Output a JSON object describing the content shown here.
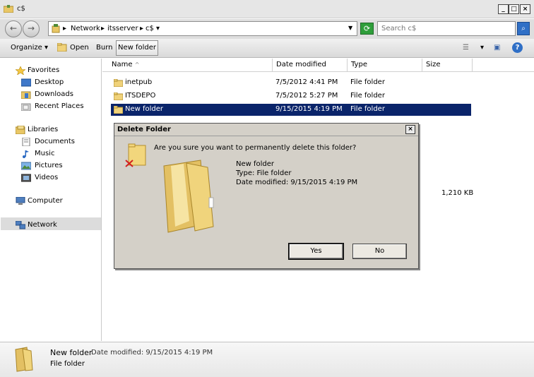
{
  "window": {
    "title": "c$"
  },
  "address": {
    "crumbs": [
      "Network",
      "itsserver",
      "c$"
    ]
  },
  "search": {
    "placeholder": "Search c$"
  },
  "toolbar": {
    "organize": "Organize",
    "open": "Open",
    "burn": "Burn",
    "new_folder": "New folder"
  },
  "nav": {
    "favorites": "Favorites",
    "desktop": "Desktop",
    "downloads": "Downloads",
    "recent_places": "Recent Places",
    "libraries": "Libraries",
    "documents": "Documents",
    "music": "Music",
    "pictures": "Pictures",
    "videos": "Videos",
    "computer": "Computer",
    "network": "Network"
  },
  "columns": {
    "name": "Name",
    "date_modified": "Date modified",
    "type": "Type",
    "size": "Size"
  },
  "files": [
    {
      "name": "inetpub",
      "date": "7/5/2012 4:41 PM",
      "type": "File folder"
    },
    {
      "name": "ITSDEPO",
      "date": "7/5/2012 5:27 PM",
      "type": "File folder"
    },
    {
      "name": "New folder",
      "date": "9/15/2015 4:19 PM",
      "type": "File folder"
    }
  ],
  "partial_size": "1,210 KB",
  "dialog": {
    "title": "Delete Folder",
    "question": "Are you sure you want to permanently delete this folder?",
    "name": "New folder",
    "type": "Type: File folder",
    "date": "Date modified: 9/15/2015 4:19 PM",
    "yes": "Yes",
    "no": "No"
  },
  "details": {
    "name": "New folder",
    "date_label": "Date modified: 9/15/2015 4:19 PM",
    "type": "File folder"
  }
}
